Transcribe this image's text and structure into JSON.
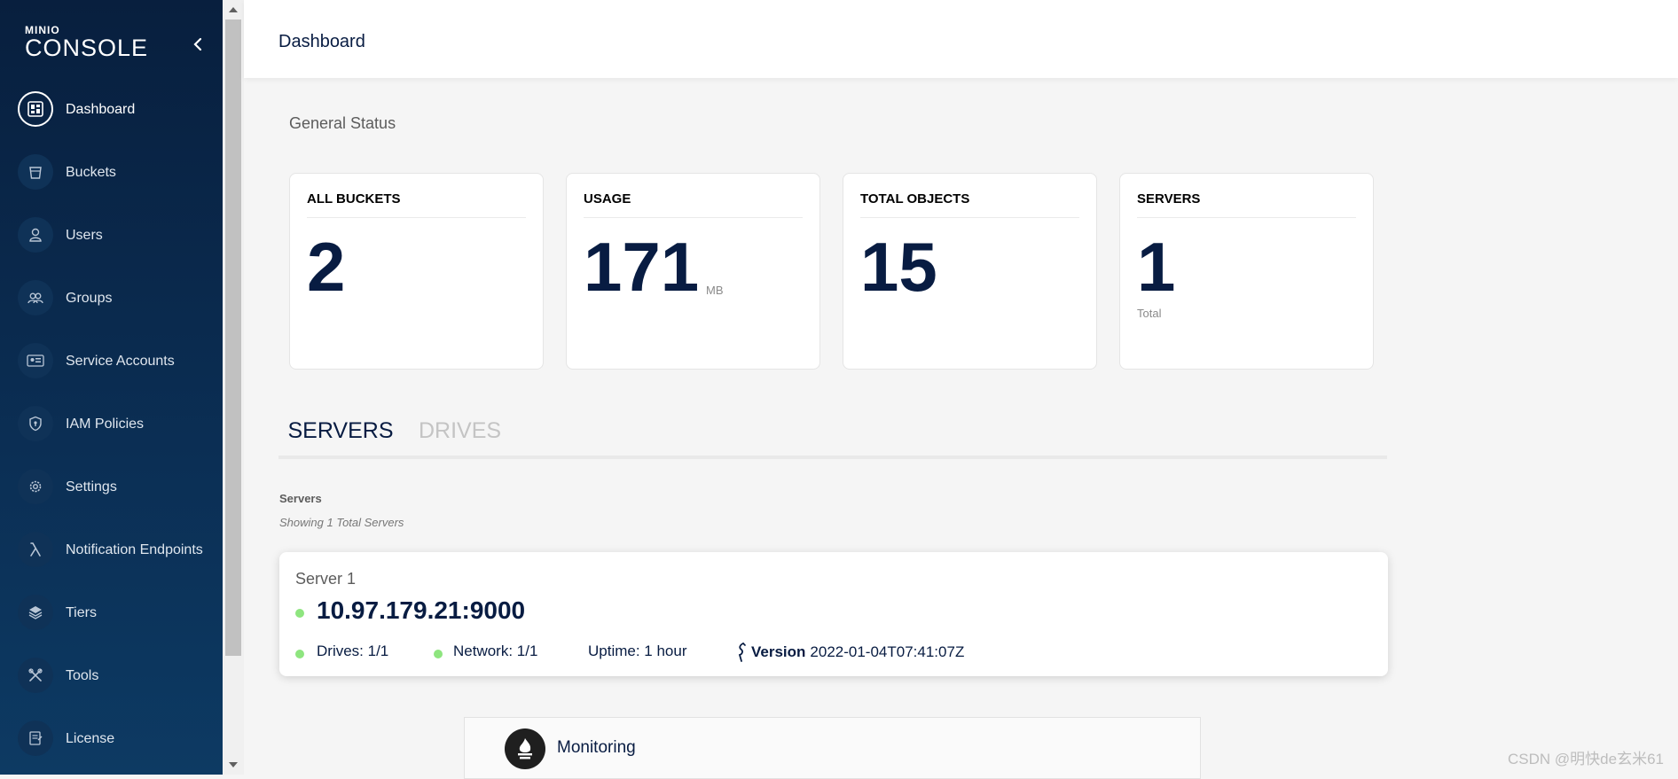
{
  "sidebar": {
    "brand": "MINIO",
    "product": "CONSOLE",
    "items": [
      {
        "label": "Dashboard",
        "icon": "dashboard-icon",
        "active": true
      },
      {
        "label": "Buckets",
        "icon": "bucket-icon"
      },
      {
        "label": "Users",
        "icon": "user-icon"
      },
      {
        "label": "Groups",
        "icon": "group-icon"
      },
      {
        "label": "Service Accounts",
        "icon": "id-card-icon"
      },
      {
        "label": "IAM Policies",
        "icon": "shield-icon"
      },
      {
        "label": "Settings",
        "icon": "gear-icon"
      },
      {
        "label": "Notification Endpoints",
        "icon": "lambda-icon"
      },
      {
        "label": "Tiers",
        "icon": "layers-icon"
      },
      {
        "label": "Tools",
        "icon": "tools-icon"
      },
      {
        "label": "License",
        "icon": "license-icon"
      }
    ]
  },
  "header": {
    "title": "Dashboard"
  },
  "status": {
    "title": "General Status",
    "cards": [
      {
        "title": "ALL BUCKETS",
        "value": "2",
        "unit": ""
      },
      {
        "title": "USAGE",
        "value": "171",
        "unit": "MB"
      },
      {
        "title": "TOTAL OBJECTS",
        "value": "15",
        "unit": ""
      },
      {
        "title": "SERVERS",
        "value": "1",
        "unit": "Total"
      }
    ]
  },
  "tabs": {
    "servers": "SERVERS",
    "drives": "DRIVES"
  },
  "servers": {
    "label": "Servers",
    "count_text": "Showing 1 Total Servers",
    "server": {
      "name": "Server 1",
      "address": "10.97.179.21:9000",
      "drives": "Drives: 1/1",
      "network": "Network: 1/1",
      "uptime": "Uptime: 1 hour",
      "version_label": "Version",
      "version": "2022-01-04T07:41:07Z"
    }
  },
  "monitoring": {
    "title": "Monitoring"
  },
  "watermark": "CSDN @明快de玄米61",
  "colors": {
    "sidebar": "#0b2f55",
    "accent": "#081c42",
    "status_ok": "#8ee57f"
  }
}
